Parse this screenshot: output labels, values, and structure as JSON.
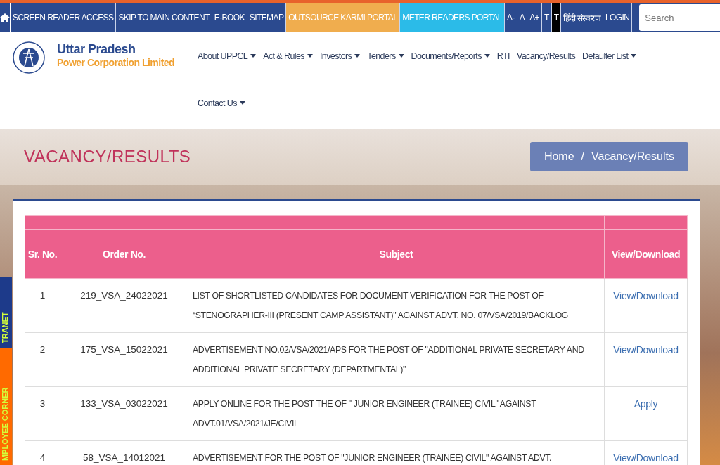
{
  "top_bar": {
    "items": [
      {
        "label": "SCREEN READER ACCESS",
        "color": "#2b4a8f"
      },
      {
        "label": "SKIP TO MAIN CONTENT",
        "color": "#2b4a8f"
      },
      {
        "label": "E-BOOK",
        "color": "#2b4a8f"
      },
      {
        "label": "SITEMAP",
        "color": "#2b4a8f"
      },
      {
        "label": "OUTSOURCE KARMI PORTAL",
        "color": "#f0ad4e"
      },
      {
        "label": "METER READERS PORTAL",
        "color": "#2bbbe8"
      },
      {
        "label": "A-",
        "color": "#2b4a8f"
      },
      {
        "label": "A",
        "color": "#2b4a8f"
      },
      {
        "label": "A+",
        "color": "#2b4a8f"
      },
      {
        "label": "T",
        "color": "#2b4a8f"
      },
      {
        "label": "T",
        "color": "#000000"
      },
      {
        "label": "हिंदी संस्करण",
        "color": "#2b4a8f"
      },
      {
        "label": "LOGIN",
        "color": "#2b4a8f"
      }
    ],
    "search": {
      "placeholder": "Search"
    }
  },
  "brand": {
    "title": "Uttar Pradesh",
    "subtitle": "Power Corporation Limited"
  },
  "nav": [
    {
      "label": "About UPPCL",
      "dropdown": true
    },
    {
      "label": "Act & Rules",
      "dropdown": true
    },
    {
      "label": "Investors",
      "dropdown": true
    },
    {
      "label": "Tenders",
      "dropdown": true
    },
    {
      "label": "Documents/Reports",
      "dropdown": true
    },
    {
      "label": "RTI",
      "dropdown": false
    },
    {
      "label": "Vacancy/Results",
      "dropdown": false
    },
    {
      "label": "Defaulter List",
      "dropdown": true
    },
    {
      "label": "Contact Us",
      "dropdown": true
    }
  ],
  "banner": {
    "title": "VACANCY/RESULTS",
    "breadcrumb": [
      "Home",
      "/",
      "Vacancy/Results"
    ]
  },
  "side_tabs": [
    {
      "label": "TRANET",
      "color": "#1d3a8a"
    },
    {
      "label": "MPLOYEE CORNER",
      "color": "#ff6a00"
    }
  ],
  "table": {
    "columns": [
      "Sr. No.",
      "Order No.",
      "Subject",
      "View/Download"
    ],
    "rows": [
      {
        "sr": "1",
        "order": "219_VSA_24022021",
        "subject": "LIST OF SHORTLISTED CANDIDATES FOR DOCUMENT VERIFICATION FOR THE POST OF “STENOGRAPHER-III (PRESENT CAMP ASSISTANT)\" AGAINST ADVT. NO. 07/VSA/2019/BACKLOG",
        "action": "View/Download"
      },
      {
        "sr": "2",
        "order": "175_VSA_15022021",
        "subject": "ADVERTISEMENT NO.02/VSA/2021/APS FOR THE POST OF \"ADDITIONAL PRIVATE SECRETARY AND ADDITIONAL PRIVATE SECRETARY (DEPARTMENTAL)\"",
        "action": "View/Download"
      },
      {
        "sr": "3",
        "order": "133_VSA_03022021",
        "subject": "APPLY ONLINE FOR THE POST THE OF \" JUNIOR ENGINEER (TRAINEE) CIVIL\" AGAINST ADVT.01/VSA/2021/JE/CIVIL",
        "action": "Apply"
      },
      {
        "sr": "4",
        "order": "58_VSA_14012021",
        "subject": "ADVERTISEMENT FOR THE POST OF \"JUNIOR ENGINEER (TRAINEE) CIVIL\" AGAINST ADVT.",
        "action": "View/Download"
      }
    ]
  }
}
